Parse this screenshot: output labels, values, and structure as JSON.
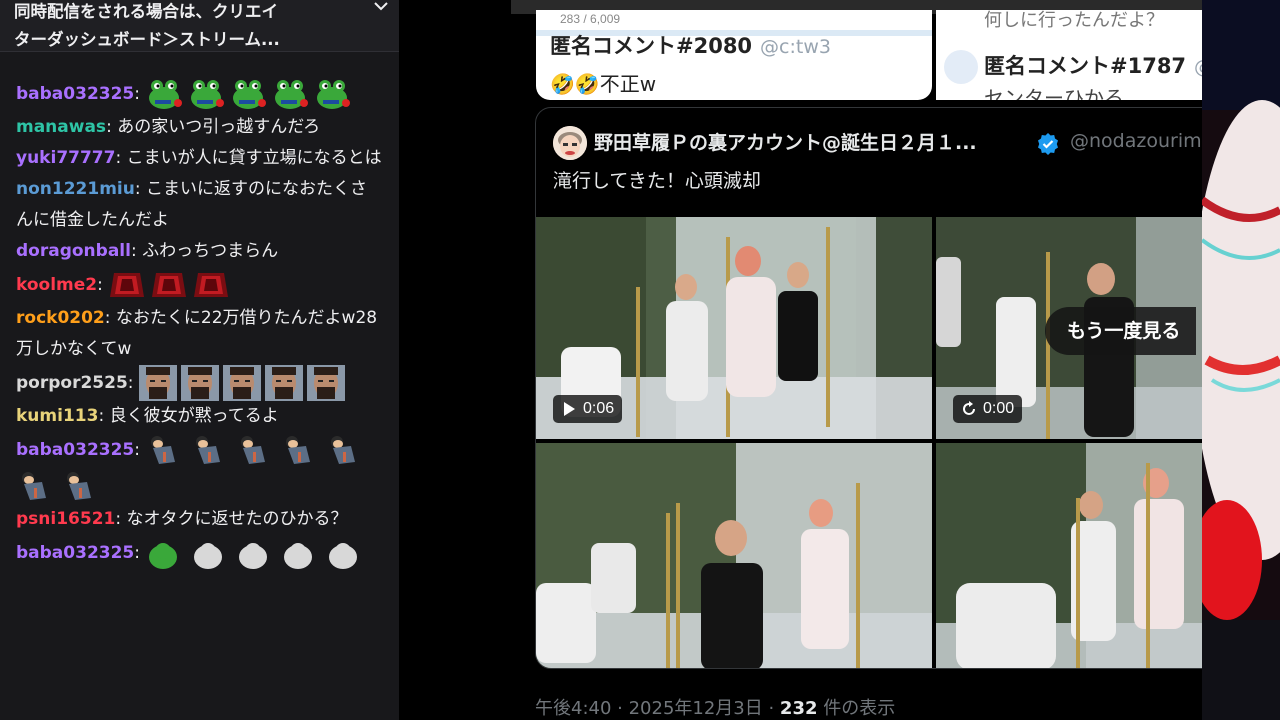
{
  "chat": {
    "header_line1": "同時配信をされる場合は、クリエイ",
    "header_line2": "ターダッシュボード＞ストリーム...",
    "messages": [
      {
        "user": "baba032325",
        "color": "#a970ff",
        "text": "",
        "emotes": "frog",
        "emote_count": 5
      },
      {
        "user": "manawas",
        "color": "#2ec4a6",
        "text": "あの家いつ引っ越すんだろ"
      },
      {
        "user": "yuki77777",
        "color": "#a970ff",
        "text": "こまいが人に貸す立場になるとは"
      },
      {
        "user": "non1221miu",
        "color": "#5b9bd5",
        "text": "こまいに返すのになおたくさんに借金したんだよ"
      },
      {
        "user": "doragonball",
        "color": "#a970ff",
        "text": "ふわっちつまらん"
      },
      {
        "user": "koolme2",
        "color": "#ff3a4e",
        "text": "",
        "emotes": "red-gem",
        "emote_count": 3
      },
      {
        "user": "rock0202",
        "color": "#ff9f1a",
        "text": "なおたくに22万借りたんだよw28万しかなくてw"
      },
      {
        "user": "porpor2525",
        "color": "#d9d9d9",
        "text": "",
        "emotes": "man-face",
        "emote_count": 5
      },
      {
        "user": "kumi113",
        "color": "#e8d37a",
        "text": "良く彼女が黙ってるよ"
      },
      {
        "user": "baba032325",
        "color": "#a970ff",
        "text": "",
        "emotes": "bowing-man",
        "emote_count": 7
      },
      {
        "user": "psni16521",
        "color": "#ff3a4e",
        "text": "なオタクに返せたのひかる？"
      },
      {
        "user": "baba032325",
        "color": "#a970ff",
        "text": "",
        "emotes": "mixed",
        "emote_count": 5
      }
    ]
  },
  "quote_left": {
    "count": "283 / 6,009",
    "name": "匿名コメント#2080",
    "handle": "@c:tw3",
    "text": "🤣🤣不正w"
  },
  "quote_right": {
    "top_text": "何しに行ったんだよ？",
    "name": "匿名コメント#1787",
    "handle": "@",
    "text": "センターひかる"
  },
  "tweet": {
    "author": "野田草履Ｐの裏アカウント@誕生日２月１...",
    "handle": "@nodazourim",
    "text": "滝行してきた！心頭滅却",
    "video1_duration": "0:06",
    "video2_duration": "0:00",
    "replay_label": "もう一度見る",
    "timestamp": "午後4:40 · 2025年12月3日 · ",
    "views_count": "232",
    "views_label": " 件の表示",
    "verified_color": "#1d9bf0"
  },
  "icons": {
    "chevron": "chevron-down-icon",
    "play": "play-icon",
    "replay": "replay-icon",
    "verified": "verified-badge-icon"
  }
}
